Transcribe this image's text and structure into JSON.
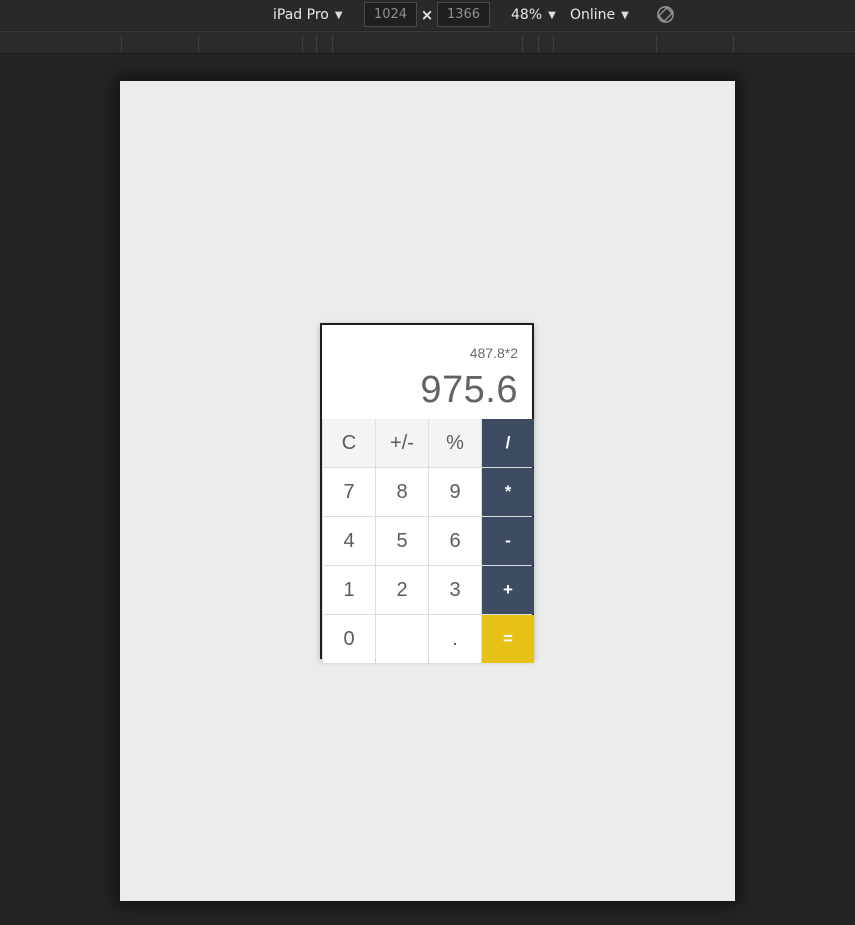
{
  "toolbar": {
    "device": "iPad Pro",
    "width": "1024",
    "times": "×",
    "height": "1366",
    "zoom": "48%",
    "network": "Online",
    "caret": "▼"
  },
  "icons": {
    "rotate": "rotate-icon",
    "dropdown": "caret-down-icon"
  },
  "calculator": {
    "expression": "487.8*2",
    "result": "975.6",
    "keys": {
      "clear": "C",
      "sign": "+/-",
      "percent": "%",
      "divide": "/",
      "seven": "7",
      "eight": "8",
      "nine": "9",
      "multiply": "*",
      "four": "4",
      "five": "5",
      "six": "6",
      "minus": "-",
      "one": "1",
      "two": "2",
      "three": "3",
      "plus": "+",
      "zero": "0",
      "blank": "",
      "dot": ".",
      "equals": "="
    }
  },
  "colors": {
    "operator": "#3d4c60",
    "equals": "#e6c217",
    "viewport": "#ebecee",
    "chrome": "#242424"
  }
}
